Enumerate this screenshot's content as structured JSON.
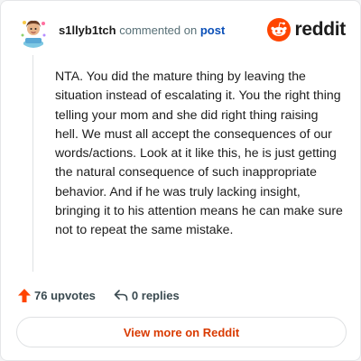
{
  "comment": {
    "author": "s1llyb1tch",
    "action_text": "commented on",
    "post_link_label": "post",
    "body": "NTA. You did the mature thing by leaving the situation instead of escalating it. You the right thing telling your mom and she did right thing raising hell. We must all accept the consequences of our words/actions. Look at it like this, he is just getting the natural consequence of such inappropriate behavior. And if he was truly lacking insight, bringing it to his attention means he can make sure not to repeat the same mistake."
  },
  "brand": {
    "wordmark": "reddit",
    "icon": "reddit-logo-icon",
    "accent": "#ff4500"
  },
  "avatar": {
    "icon": "cartoon-avatar-icon"
  },
  "actions": {
    "upvotes": "76 upvotes",
    "replies": "0 replies",
    "upvote_icon": "upvote-arrow-icon",
    "reply_icon": "reply-arrow-icon"
  },
  "cta": {
    "label": "View more on Reddit"
  },
  "colors": {
    "cta_text": "#d93a00",
    "link": "#0a4fb8",
    "upvote": "#ff4500"
  }
}
